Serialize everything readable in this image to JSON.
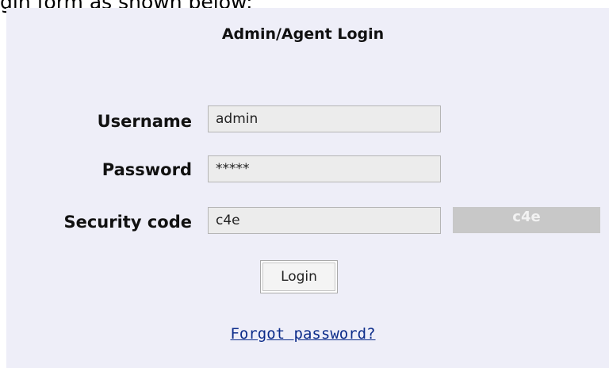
{
  "caption": "gin form as shown below:",
  "form": {
    "title": "Admin/Agent Login",
    "username": {
      "label": "Username",
      "value": "admin"
    },
    "password": {
      "label": "Password",
      "value": "*****"
    },
    "security_code": {
      "label": "Security code",
      "value": "c4e",
      "captcha_text": "c4e"
    },
    "login_button": "Login",
    "forgot_link": "Forgot password?"
  }
}
